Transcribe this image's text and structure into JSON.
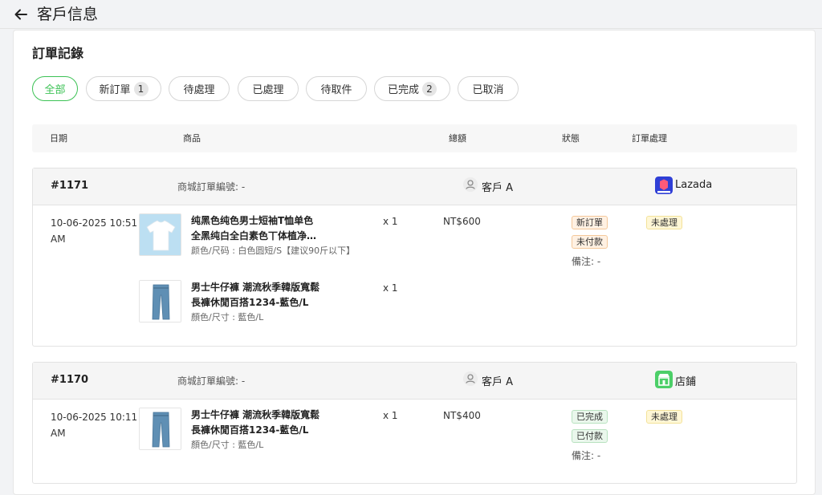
{
  "header": {
    "title": "客戶信息",
    "back_icon": "arrow-left-icon"
  },
  "section": {
    "title": "訂單記錄"
  },
  "filters": [
    {
      "label": "全部",
      "count": "",
      "active": true
    },
    {
      "label": "新訂單",
      "count": "1"
    },
    {
      "label": "待處理",
      "count": ""
    },
    {
      "label": "已處理",
      "count": ""
    },
    {
      "label": "待取件",
      "count": ""
    },
    {
      "label": "已完成",
      "count": "2"
    },
    {
      "label": "已取消",
      "count": ""
    }
  ],
  "table": {
    "headers": {
      "date": "日期",
      "product": "商品",
      "total": "總額",
      "status": "狀態",
      "processing": "訂單處理"
    }
  },
  "orders": [
    {
      "id": "#1171",
      "mall_order_no": "商城訂單編號: -",
      "customer": "客戶 A",
      "channel": "Lazada",
      "channel_icon": "lazada-logo-icon",
      "date_line1": "10-06-2025 10:51",
      "date_line2": "AM",
      "total": "NT$600",
      "status_tags": [
        "新訂單",
        "未付款"
      ],
      "note": "備注: -",
      "processing": "未處理",
      "items": [
        {
          "name_line1": "纯黑色纯色男士短袖T恤单色",
          "name_line2": "全黑纯白全白素色丅体植净…",
          "variant": "颜色/尺码 : 白色圆短/S【建议90斤以下】",
          "qty": "x 1",
          "image": "white-tshirt-image"
        },
        {
          "name_line1": "男士牛仔褲 潮流秋季韓版寬鬆",
          "name_line2": "長褲休閒百搭1234-藍色/L",
          "variant": "顏色/尺寸 : 藍色/L",
          "qty": "x 1",
          "image": "blue-jeans-image"
        }
      ]
    },
    {
      "id": "#1170",
      "mall_order_no": "商城訂單編號: -",
      "customer": "客戶 A",
      "channel": "店鋪",
      "channel_icon": "store-icon",
      "date_line1": "10-06-2025 10:11",
      "date_line2": "AM",
      "total": "NT$400",
      "status_tags": [
        "已完成",
        "已付款"
      ],
      "note": "備注: -",
      "processing": "未處理",
      "items": [
        {
          "name_line1": "男士牛仔褲 潮流秋季韓版寬鬆",
          "name_line2": "長褲休閒百搭1234-藍色/L",
          "variant": "顏色/尺寸 : 藍色/L",
          "qty": "x 1",
          "image": "blue-jeans-image"
        }
      ]
    }
  ],
  "colors": {
    "accent": "#3cc255",
    "lazada": "#2f3fd6",
    "store": "#4ccf68"
  }
}
